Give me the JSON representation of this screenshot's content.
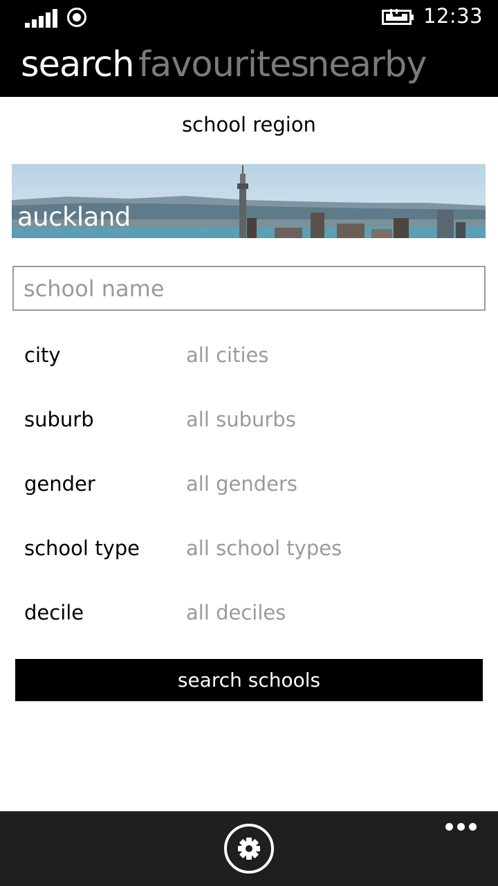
{
  "status_bar": {
    "time": "12:33",
    "signal_icon": "signal-strength-icon",
    "sim_icon": "sim-indicator-icon",
    "battery_icon": "battery-charging-icon"
  },
  "pivot": {
    "tabs": [
      {
        "label": "search",
        "active": true
      },
      {
        "label": "favourites",
        "active": false
      },
      {
        "label": "nearby",
        "active": false
      }
    ]
  },
  "region": {
    "title": "school region",
    "selected": "auckland"
  },
  "school_name": {
    "value": "",
    "placeholder": "school name"
  },
  "filters": [
    {
      "label": "city",
      "value": "all cities"
    },
    {
      "label": "suburb",
      "value": "all suburbs"
    },
    {
      "label": "gender",
      "value": "all genders"
    },
    {
      "label": "school type",
      "value": "all school types"
    },
    {
      "label": "decile",
      "value": "all deciles"
    }
  ],
  "search_button": {
    "label": "search schools"
  },
  "app_bar": {
    "settings_icon": "gear-icon",
    "more_icon": "ellipsis-icon"
  },
  "colors": {
    "header_bg": "#000000",
    "active_tab": "#ffffff",
    "inactive_tab": "#7b7b7b",
    "muted_text": "#9a9a9a",
    "app_bar_bg": "#1f1f1f"
  }
}
